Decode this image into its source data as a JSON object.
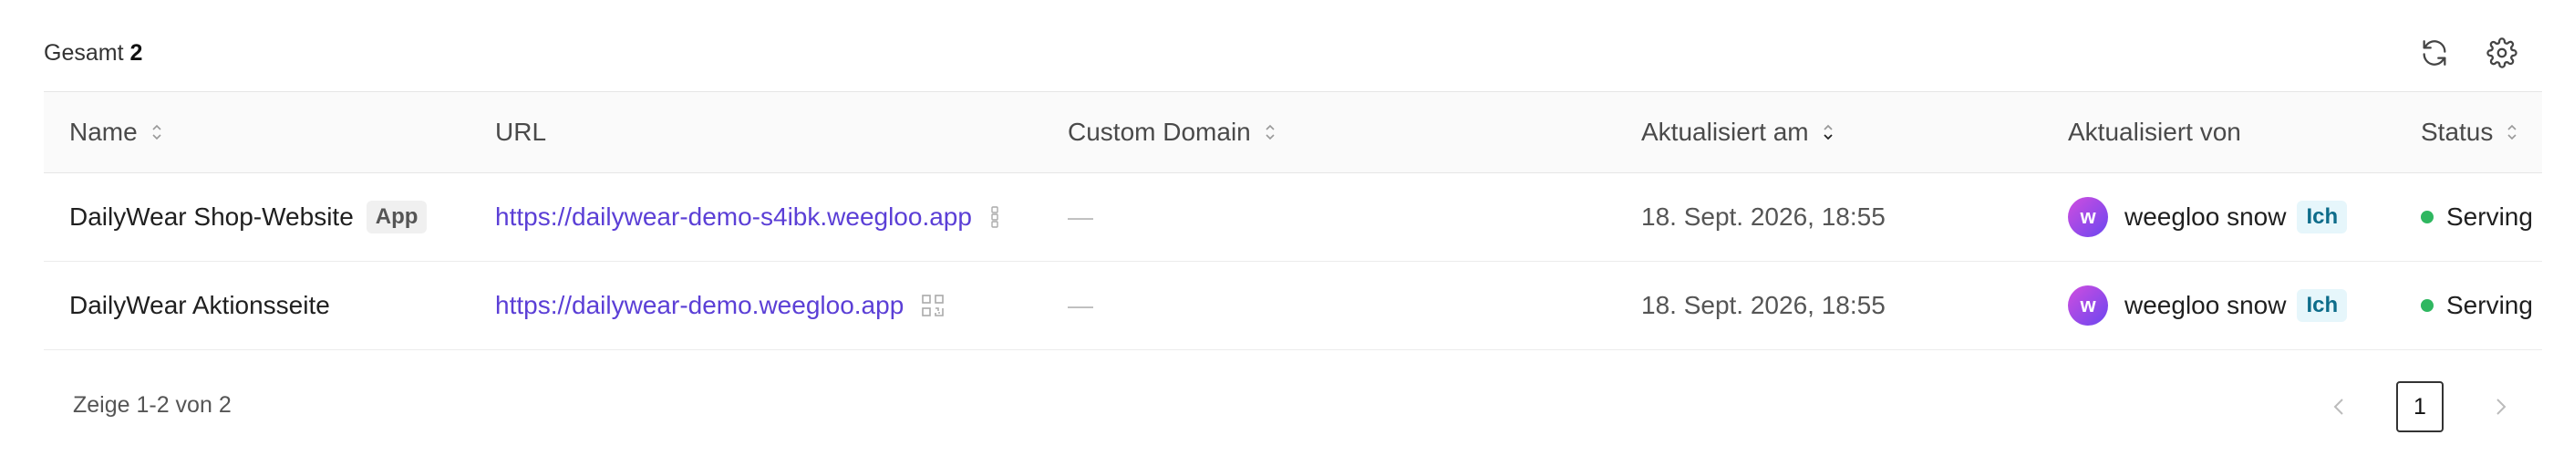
{
  "header": {
    "total_label": "Gesamt",
    "total_count": "2",
    "icons": [
      "refresh-icon",
      "gear-icon"
    ]
  },
  "table": {
    "columns": [
      "Name",
      "URL",
      "Custom Domain",
      "Aktualisiert am",
      "Aktualisiert von",
      "Status"
    ],
    "rows": [
      {
        "name": "DailyWear Shop-Website",
        "name_badge": "App",
        "url": "https://dailywear-demo-s4ibk.weegloo.app",
        "custom_domain": "—",
        "updated_at": "18. Sept. 2026, 18:55",
        "updated_by": "weegloo snow",
        "updated_by_badge": "Ich",
        "avatar_letter": "w",
        "status": "Serving"
      },
      {
        "name": "DailyWear Aktionsseite",
        "url": "https://dailywear-demo.weegloo.app",
        "custom_domain": "—",
        "updated_at": "18. Sept. 2026, 18:55",
        "updated_by": "weegloo snow",
        "updated_by_badge": "Ich",
        "avatar_letter": "w",
        "status": "Serving"
      }
    ]
  },
  "footer": {
    "range_text": "Zeige 1-2 von 2",
    "current_page": "1"
  },
  "colors": {
    "link": "#5b3fd6",
    "status_serving": "#2fb760",
    "badge_me_bg": "#e6f6fb"
  }
}
